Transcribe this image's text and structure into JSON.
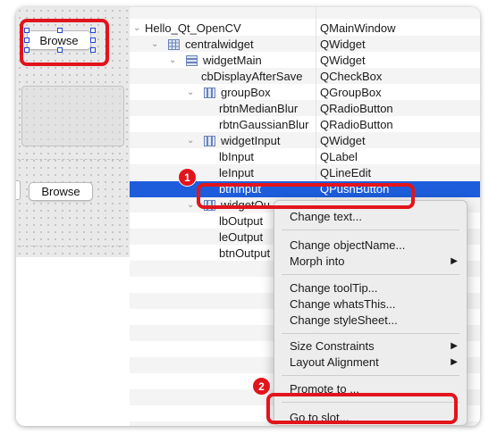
{
  "canvas": {
    "browse_button_top": "Browse",
    "browse_button_middle": "Browse"
  },
  "tree": {
    "rows": [
      {
        "object": "Hello_Qt_OpenCV",
        "class": "QMainWindow"
      },
      {
        "object": "centralwidget",
        "class": "QWidget"
      },
      {
        "object": "widgetMain",
        "class": "QWidget"
      },
      {
        "object": "cbDisplayAfterSave",
        "class": "QCheckBox"
      },
      {
        "object": "groupBox",
        "class": "QGroupBox"
      },
      {
        "object": "rbtnMedianBlur",
        "class": "QRadioButton"
      },
      {
        "object": "rbtnGaussianBlur",
        "class": "QRadioButton"
      },
      {
        "object": "widgetInput",
        "class": "QWidget"
      },
      {
        "object": "lbInput",
        "class": "QLabel"
      },
      {
        "object": "leInput",
        "class": "QLineEdit"
      },
      {
        "object": "btnInput",
        "class": "QPushButton",
        "selected": true
      },
      {
        "object": "widgetOu",
        "class": ""
      },
      {
        "object": "lbOutput",
        "class": ""
      },
      {
        "object": "leOutput",
        "class": ""
      },
      {
        "object": "btnOutput",
        "class": ""
      }
    ]
  },
  "context_menu": {
    "items": [
      {
        "label": "Change text..."
      },
      {
        "label": "Change objectName..."
      },
      {
        "label": "Morph into",
        "submenu": true
      },
      {
        "label": "Change toolTip..."
      },
      {
        "label": "Change whatsThis..."
      },
      {
        "label": "Change styleSheet..."
      },
      {
        "label": "Size Constraints",
        "submenu": true
      },
      {
        "label": "Layout Alignment",
        "submenu": true
      },
      {
        "label": "Promote to ..."
      },
      {
        "label": "Go to slot..."
      }
    ]
  },
  "annotations": {
    "badge_1": "1",
    "badge_2": "2"
  },
  "colors": {
    "highlight": "#e2141c",
    "selection": "#1d5ddb",
    "selection_handles": "#1e45d8"
  },
  "icons": {
    "submenu_arrow": "▶",
    "expand_chevron": "⌄",
    "layout_grid_icon": "grid-layout-icon",
    "layout_vertical_icon": "vertical-layout-icon",
    "layout_horizontal_icon": "horizontal-layout-icon"
  }
}
